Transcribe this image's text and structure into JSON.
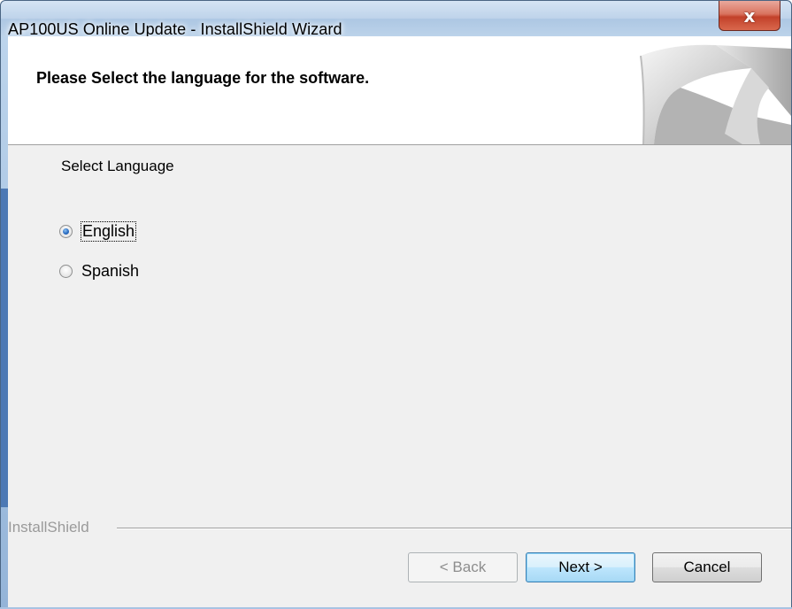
{
  "window": {
    "title": "AP100US Online Update - InstallShield Wizard",
    "close_symbol": "x"
  },
  "header": {
    "title": "Please Select the language for the software."
  },
  "language": {
    "section_label": "Select Language",
    "options": [
      {
        "label": "English",
        "selected": true
      },
      {
        "label": "Spanish",
        "selected": false
      }
    ]
  },
  "branding": {
    "label": "InstallShield"
  },
  "buttons": {
    "back_label": "< Back",
    "next_label": "Next >",
    "cancel_label": "Cancel"
  },
  "colors": {
    "accent": "#4d79b4",
    "close_red": "#c2412a",
    "default_button_border": "#3c7fb1"
  }
}
